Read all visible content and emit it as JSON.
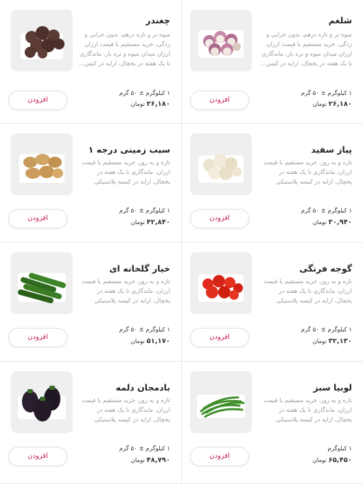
{
  "products": [
    {
      "title": "شلغم",
      "description": "میوه تر و تازه درهم، بدون خرابی و زدگی، خرید مستقیم با قیمت ارزان ارزان میدان میوه و تره بار، ماندگاری تا یک هفته در یخچال، ارایه در کیس...",
      "weight": "۱ کیلوگرم ± ۵۰ گرم",
      "price": "۲۶,۱۸۰",
      "currency": "تومان",
      "add_label": "افزودن",
      "image_icon": "turnip-icon"
    },
    {
      "title": "چغندر",
      "description": "میوه تر و تازه درهم، بدون خرابی و زدگی، خرید مستقیم با قیمت ارزان ارزان میدان میوه و تره بار، ماندگاری تا یک هفته در یخچال، ارایه در کیس...",
      "weight": "۱ کیلوگرم ± ۵۰ گرم",
      "price": "۲۶,۱۸۰",
      "currency": "تومان",
      "add_label": "افزودن",
      "image_icon": "beetroot-icon"
    },
    {
      "title": "پیاز سفید",
      "description": "تازه و به روز، خرید مستقیم با قیمت ارزان، ماندگاری تا یک هفته در یخچال، ارایه در کیسه پلاستیکی",
      "weight": "۱ کیلوگرم ± ۵۰ گرم",
      "price": "۳۰,۹۴۰",
      "currency": "تومان",
      "add_label": "افزودن",
      "image_icon": "white-onion-icon"
    },
    {
      "title": "سیب زمینی درجه ۱",
      "description": "تازه و به روز، خرید مستقیم با قیمت ارزان، ماندگاری تا یک هفته در یخچال، ارایه در کیسه پلاستیکی",
      "weight": "۱ کیلوگرم ± ۵۰ گرم",
      "price": "۴۲,۸۴۰",
      "currency": "تومان",
      "add_label": "افزودن",
      "image_icon": "potato-icon"
    },
    {
      "title": "گوجه فرنگی",
      "description": "تازه و به روز، خرید مستقیم با قیمت ارزان، ماندگاری تا یک هفته در یخچال، ارایه در کیسه پلاستیکی",
      "weight": "۱ کیلوگرم ± ۵۰ گرم",
      "price": "۳۲,۱۳۰",
      "currency": "تومان",
      "add_label": "افزودن",
      "image_icon": "tomato-icon"
    },
    {
      "title": "خیار گلخانه ای",
      "description": "تازه و به روز، خرید مستقیم با قیمت ارزان، ماندگاری تا یک هفته در یخچال، ارایه در کیسه پلاستیکی",
      "weight": "۱ کیلوگرم ± ۵۰ گرم",
      "price": "۵۱,۱۷۰",
      "currency": "تومان",
      "add_label": "افزودن",
      "image_icon": "cucumber-icon"
    },
    {
      "title": "لوبیا سبز",
      "description": "تازه و به روز، خرید مستقیم با قیمت ارزان، ماندگاری تا یک هفته در یخچال، ارایه در کیسه پلاستیکی",
      "weight": "۱ کیلوگرم",
      "price": "۶۵,۴۵۰",
      "currency": "تومان",
      "add_label": "افزودن",
      "image_icon": "green-bean-icon"
    },
    {
      "title": "بادمجان دلمه",
      "description": "تازه و به روز، خرید مستقیم با قیمت ارزان، ماندگاری تا یک هفته در یخچال، ارایه در کیسه پلاستیکی",
      "weight": "۱ کیلوگرم ± ۵۰ گرم",
      "price": "۴۸,۷۹۰",
      "currency": "تومان",
      "add_label": "افزودن",
      "image_icon": "eggplant-icon"
    }
  ],
  "colors": {
    "accent": "#c2185b",
    "text": "#222222",
    "muted": "#9a9a9a",
    "thumb_bg": "#efefef"
  }
}
